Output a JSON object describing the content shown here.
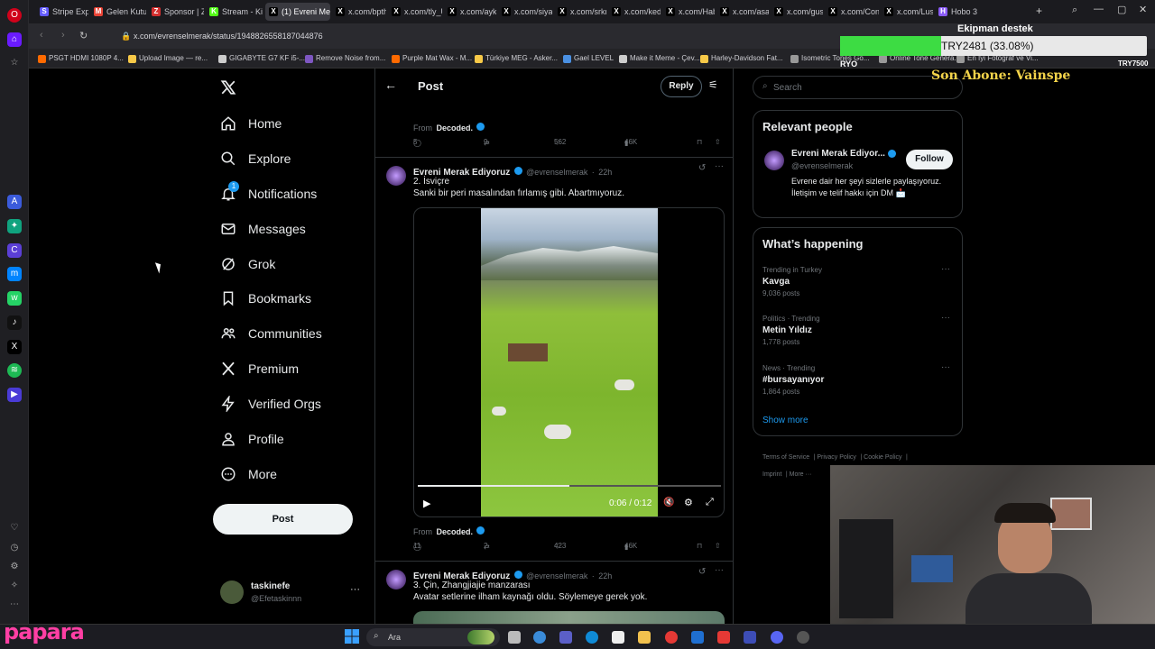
{
  "browser": {
    "url": "x.com/evrenselmerak/status/1948826558187044876",
    "tabs": [
      {
        "label": "Stripe Expr",
        "icon": "S",
        "color": "#635bff"
      },
      {
        "label": "Gelen Kutu",
        "icon": "M",
        "color": "#ea4335"
      },
      {
        "label": "Sponsor | Z",
        "icon": "Z",
        "color": "#d32f2f"
      },
      {
        "label": "Stream - Ki",
        "icon": "K",
        "color": "#53fc18"
      },
      {
        "label": "(1) Evreni Merak Ed",
        "icon": "X",
        "color": "#000000"
      },
      {
        "label": "x.com/bpth",
        "icon": "X",
        "color": "#000000"
      },
      {
        "label": "x.com/tly_U",
        "icon": "X",
        "color": "#000000"
      },
      {
        "label": "x.com/ayki",
        "icon": "X",
        "color": "#000000"
      },
      {
        "label": "x.com/siyat",
        "icon": "X",
        "color": "#000000"
      },
      {
        "label": "x.com/srkm",
        "icon": "X",
        "color": "#000000"
      },
      {
        "label": "x.com/kedi",
        "icon": "X",
        "color": "#000000"
      },
      {
        "label": "x.com/Hab",
        "icon": "X",
        "color": "#000000"
      },
      {
        "label": "x.com/asay",
        "icon": "X",
        "color": "#000000"
      },
      {
        "label": "x.com/gush",
        "icon": "X",
        "color": "#000000"
      },
      {
        "label": "x.com/Con",
        "icon": "X",
        "color": "#000000"
      },
      {
        "label": "x.com/Lusl",
        "icon": "X",
        "color": "#000000"
      },
      {
        "label": "Hobo 3",
        "icon": "H",
        "color": "#8b5cf6"
      }
    ],
    "bookmarks": [
      {
        "label": "PSGT HDMI 1080P 4...",
        "color": "#ff6a00"
      },
      {
        "label": "Upload Image — re...",
        "color": "#f7c948"
      },
      {
        "label": "GIGABYTE G7 KF i5-...",
        "color": "#cccccc"
      },
      {
        "label": "Remove Noise from...",
        "color": "#7e57c2"
      },
      {
        "label": "Purple Mat Wax - M...",
        "color": "#ff6a00"
      },
      {
        "label": "Türkiye MEG - Asker...",
        "color": "#f7c948"
      },
      {
        "label": "Gael LEVEL",
        "color": "#4a90e2"
      },
      {
        "label": "Make it Meme - Çev...",
        "color": "#cccccc"
      },
      {
        "label": "Harley-Davidson Fat...",
        "color": "#f7c948"
      },
      {
        "label": "Isometric Tones Go...",
        "color": "#999999"
      },
      {
        "label": "Online Tone Genera...",
        "color": "#999999"
      },
      {
        "label": "En İyi Fotoğraf ve Vi...",
        "color": "#999999"
      }
    ]
  },
  "overlay": {
    "goal_title": "Ekipman destek",
    "goal_value": "TRY2481 (33.08%)",
    "goal_progress": 0.3308,
    "goal_min": "RYO",
    "goal_max": "TRY7500",
    "last_sub": "Son Abone: Vainspe",
    "brand": "papara"
  },
  "nav": {
    "items": [
      "Home",
      "Explore",
      "Notifications",
      "Messages",
      "Grok",
      "Bookmarks",
      "Communities",
      "Premium",
      "Verified Orgs",
      "Profile",
      "More"
    ],
    "notif_badge": "1",
    "post_button": "Post",
    "account_name": "taskinefe",
    "account_handle": "@Efetaskinnn"
  },
  "header": {
    "title": "Post",
    "reply_button": "Reply"
  },
  "posts": [
    {
      "from_label": "From",
      "from_source": "Decoded.",
      "replies": "5",
      "reposts": "9",
      "likes": "562",
      "views": "46K"
    },
    {
      "author": "Evreni Merak Ediyoruz",
      "handle": "@evrenselmerak",
      "time": "22h",
      "line1": "2. İsviçre",
      "line2": "Sanki bir peri masalından fırlamış gibi. Abartmıyoruz.",
      "video_time": "0:06 / 0:12",
      "video_progress": 0.5,
      "from_label": "From",
      "from_source": "Decoded.",
      "replies": "11",
      "reposts": "2",
      "likes": "423",
      "views": "46K"
    },
    {
      "author": "Evreni Merak Ediyoruz",
      "handle": "@evrenselmerak",
      "time": "22h",
      "line1": "3. Çin, Zhangjiajie manzarası",
      "line2": "Avatar setlerine ilham kaynağı oldu. Söylemeye gerek yok."
    }
  ],
  "search": {
    "placeholder": "Search"
  },
  "relevant": {
    "title": "Relevant people",
    "name": "Evreni Merak Ediyor...",
    "handle": "@evrenselmerak",
    "follow": "Follow",
    "bio": "Evrene dair her şeyi sizlerle paylaşıyoruz. İletişim ve telif hakkı için DM 📩"
  },
  "happening": {
    "title": "What’s happening",
    "trends": [
      {
        "cat": "Trending in Turkey",
        "name": "Kavga",
        "count": "9,036 posts"
      },
      {
        "cat": "Politics · Trending",
        "name": "Metin Yıldız",
        "count": "1,778 posts"
      },
      {
        "cat": "News · Trending",
        "name": "#bursayanıyor",
        "count": "1,864 posts"
      }
    ],
    "show_more": "Show more"
  },
  "footer": [
    "Terms of Service",
    "Privacy Policy",
    "Cookie Policy",
    "Imprint",
    "More ···"
  ],
  "taskbar": {
    "search_placeholder": "Ara"
  },
  "colors": {
    "accent": "#1d9bf0",
    "verified": "#1d9bf0",
    "bg": "#000000",
    "border": "#2f3336",
    "muted": "#71767b"
  }
}
